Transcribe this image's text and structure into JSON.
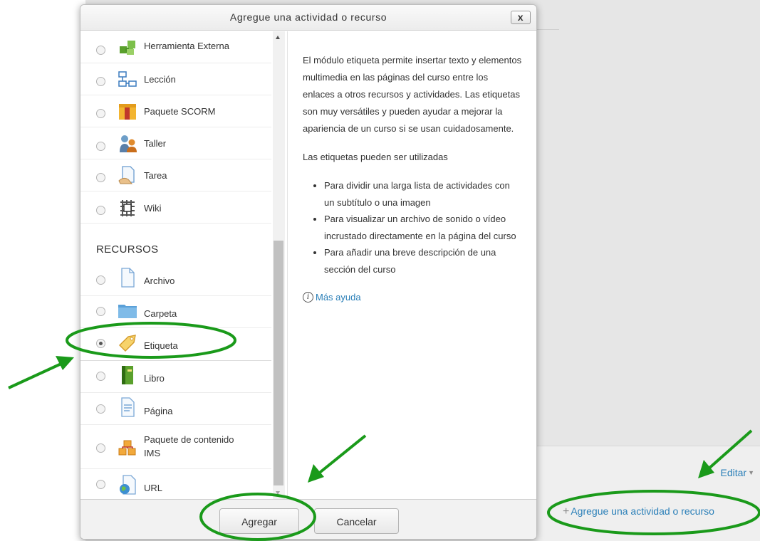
{
  "dialog": {
    "title": "Agregue una actividad o recurso",
    "close_label": "x",
    "activities": [
      {
        "label": "Herramienta Externa",
        "icon": "puzzle-icon"
      },
      {
        "label": "Lección",
        "icon": "lesson-icon"
      },
      {
        "label": "Paquete SCORM",
        "icon": "scorm-package-icon"
      },
      {
        "label": "Taller",
        "icon": "workshop-icon"
      },
      {
        "label": "Tarea",
        "icon": "assignment-icon"
      },
      {
        "label": "Wiki",
        "icon": "wiki-icon"
      }
    ],
    "resources_heading": "RECURSOS",
    "resources": [
      {
        "label": "Archivo",
        "icon": "file-icon"
      },
      {
        "label": "Carpeta",
        "icon": "folder-icon"
      },
      {
        "label": "Etiqueta",
        "icon": "label-tag-icon",
        "selected": true
      },
      {
        "label": "Libro",
        "icon": "book-icon"
      },
      {
        "label": "Página",
        "icon": "page-icon"
      },
      {
        "label_line1": "Paquete de contenido",
        "label_line2": "IMS",
        "icon": "ims-package-icon"
      },
      {
        "label": "URL",
        "icon": "url-icon"
      }
    ],
    "help": {
      "paragraph1": "El módulo etiqueta permite insertar texto y elementos multimedia en las páginas del curso entre los enlaces a otros recursos y actividades. Las etiquetas son muy versátiles y pueden ayudar a mejorar la apariencia de un curso si se usan cuidadosamente.",
      "paragraph2": "Las etiquetas pueden ser utilizadas",
      "bullets": [
        "Para dividir una larga lista de actividades con un subtítulo o una imagen",
        "Para visualizar un archivo de sonido o vídeo incrustado directamente en la página del curso",
        "Para añadir una breve descripción de una sección del curso"
      ],
      "more_help": "Más ayuda"
    },
    "add_button": "Agregar",
    "cancel_button": "Cancelar"
  },
  "page": {
    "edit_link": "Editar",
    "add_activity_link": "Agregue una actividad o recurso"
  },
  "colors": {
    "link": "#2a7fb8",
    "annotation": "#1a9a1a"
  }
}
